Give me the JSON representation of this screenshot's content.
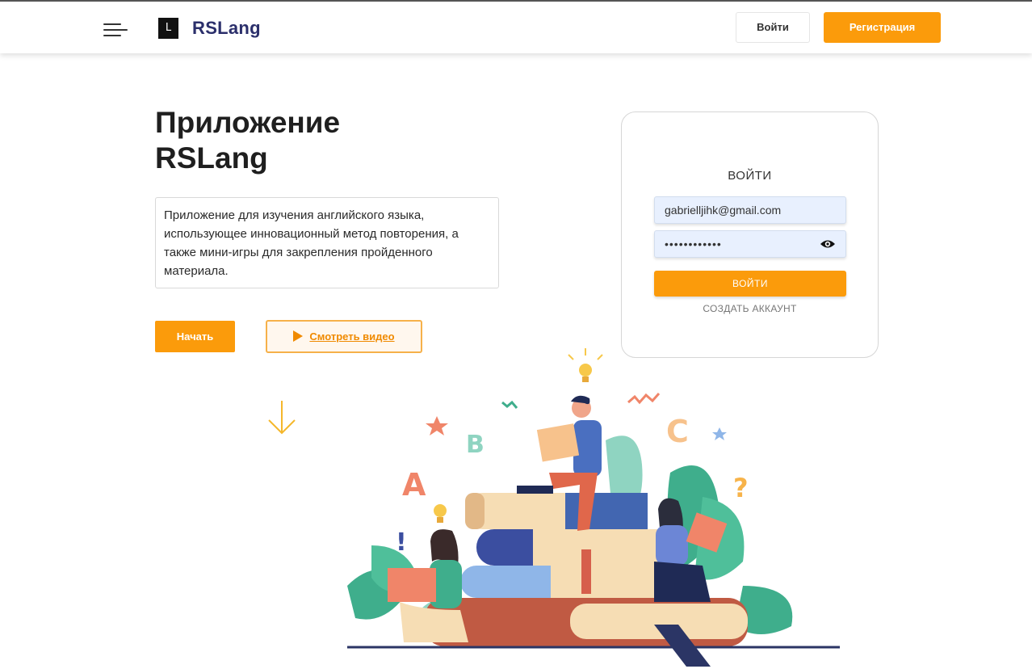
{
  "header": {
    "logo_mark": "L",
    "logo_text": "RSLang",
    "login_label": "Войти",
    "register_label": "Регистрация"
  },
  "hero": {
    "title_line1": "Приложение",
    "title_line2": "RSLang",
    "description": "Приложение для изучения английского языка, использующее инновационный метод повторения, а также мини-игры для закрепления пройденного материала.",
    "start_label": "Начать",
    "video_label": "Смотреть видео"
  },
  "login_form": {
    "title": "ВОЙТИ",
    "email_value": "gabrielljihk@gmail.com",
    "password_value": "••••••••••••",
    "submit_label": "ВОЙТИ",
    "create_account_label": "СОЗДАТЬ АККАУНТ"
  },
  "illustration": {
    "letters": [
      "A",
      "B",
      "C"
    ],
    "symbols": [
      "!",
      "?"
    ]
  },
  "colors": {
    "accent": "#fb9b0b",
    "logo_text": "#2b2f6b",
    "input_bg": "#e8f0fe"
  },
  "icons": {
    "menu": "hamburger-menu-icon",
    "play": "play-icon",
    "eye": "eye-icon",
    "arrow": "arrow-down-icon"
  }
}
